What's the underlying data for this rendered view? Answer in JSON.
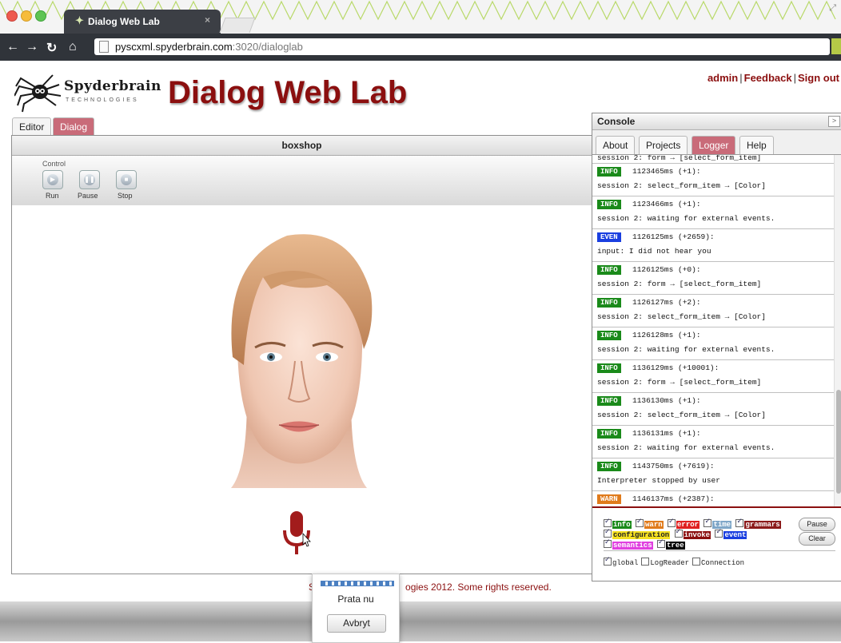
{
  "browser": {
    "tab_title": "Dialog Web Lab",
    "tab_close": "×",
    "url_host": "pyscxml.spyderbrain.com",
    "url_path": ":3020/dialoglab"
  },
  "header": {
    "logo_brand": "Spyderbrain",
    "logo_sub": "TECHNOLOGIES",
    "title": "Dialog Web Lab",
    "links": [
      "admin",
      "Feedback",
      "Sign out"
    ]
  },
  "editor": {
    "tabs": [
      "Editor",
      "Dialog"
    ],
    "active_tab": "Dialog",
    "panel_title": "boxshop",
    "control_label": "Control",
    "controls": [
      "Run",
      "Pause",
      "Stop"
    ]
  },
  "console": {
    "title": "Console",
    "tabs": [
      "About",
      "Projects",
      "Logger",
      "Help"
    ],
    "active_tab": "Logger",
    "log_top_partial": "session 2: form → [select_form_item]",
    "log": [
      {
        "level": "INFO",
        "meta": "1123465ms (+1):",
        "msg": "session 2: select_form_item → [Color]"
      },
      {
        "level": "INFO",
        "meta": "1123466ms (+1):",
        "msg": "session 2: waiting for external events."
      },
      {
        "level": "EVEN",
        "meta": "1126125ms (+2659):",
        "msg": "input: I did not hear you"
      },
      {
        "level": "INFO",
        "meta": "1126125ms (+0):",
        "msg": "session 2: form → [select_form_item]"
      },
      {
        "level": "INFO",
        "meta": "1126127ms (+2):",
        "msg": "session 2: select_form_item → [Color]"
      },
      {
        "level": "INFO",
        "meta": "1126128ms (+1):",
        "msg": "session 2: waiting for external events."
      },
      {
        "level": "INFO",
        "meta": "1136129ms (+10001):",
        "msg": "session 2: form → [select_form_item]"
      },
      {
        "level": "INFO",
        "meta": "1136130ms (+1):",
        "msg": "session 2: select_form_item → [Color]"
      },
      {
        "level": "INFO",
        "meta": "1136131ms (+1):",
        "msg": "session 2: waiting for external events."
      },
      {
        "level": "INFO",
        "meta": "1143750ms (+7619):",
        "msg": "Interpreter stopped by user"
      },
      {
        "level": "WARN",
        "meta": "1146137ms (+2387):",
        "msg": ""
      }
    ],
    "filters": [
      {
        "label": "info",
        "color": "#1a8a1a",
        "text_color": "#ffffff"
      },
      {
        "label": "warn",
        "color": "#e07b1c",
        "text_color": "#ffffff"
      },
      {
        "label": "error",
        "color": "#e02020",
        "text_color": "#ffffff"
      },
      {
        "label": "time",
        "color": "#7fa7c8",
        "text_color": "#ffffff"
      },
      {
        "label": "grammars",
        "color": "#8b1a1a",
        "text_color": "#ffffff"
      },
      {
        "label": "configuration",
        "color": "#f5e020",
        "text_color": "#222222"
      },
      {
        "label": "invoke",
        "color": "#8b0f0f",
        "text_color": "#ffffff"
      },
      {
        "label": "event",
        "color": "#1a3fe0",
        "text_color": "#ffffff"
      },
      {
        "label": "semantics",
        "color": "#e040e0",
        "text_color": "#ffffff"
      },
      {
        "label": "tree",
        "color": "#000000",
        "text_color": "#ffffff"
      }
    ],
    "pause_label": "Pause",
    "clear_label": "Clear",
    "sources": [
      {
        "label": "global",
        "checked": true
      },
      {
        "label": "LogReader",
        "checked": false
      },
      {
        "label": "Connection",
        "checked": false
      }
    ]
  },
  "footer": {
    "visible_left": "S",
    "visible_right": "ogies 2012. Some rights reserved."
  },
  "speech_popup": {
    "text": "Prata nu",
    "cancel": "Avbryt"
  },
  "colors": {
    "brand_red": "#8b0f0f",
    "tab_active": "#c96b79",
    "info_badge": "#1a8a1a",
    "event_badge": "#1a3fe0",
    "warn_badge": "#e07b1c"
  }
}
